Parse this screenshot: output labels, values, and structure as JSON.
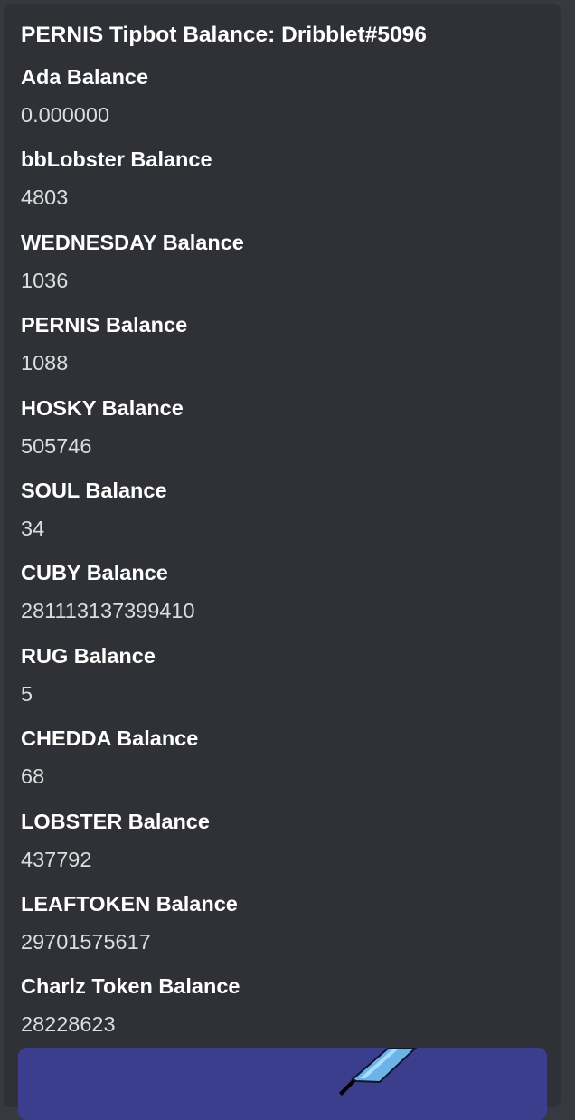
{
  "embed": {
    "title": "PERNIS Tipbot Balance: Dribblet#5096",
    "fields": [
      {
        "name": "Ada Balance",
        "value": "0.000000"
      },
      {
        "name": "bbLobster Balance",
        "value": "4803"
      },
      {
        "name": "WEDNESDAY Balance",
        "value": "1036"
      },
      {
        "name": "PERNIS Balance",
        "value": "1088"
      },
      {
        "name": "HOSKY Balance",
        "value": "505746"
      },
      {
        "name": "SOUL Balance",
        "value": "34"
      },
      {
        "name": "CUBY Balance",
        "value": "28111313739​9410"
      },
      {
        "name": "RUG Balance",
        "value": "5"
      },
      {
        "name": "CHEDDA Balance",
        "value": "68"
      },
      {
        "name": "LOBSTER Balance",
        "value": "437792"
      },
      {
        "name": "LEAFTOKEN Balance",
        "value": "29701575617"
      },
      {
        "name": "Charlz Token Balance",
        "value": "28228623"
      }
    ]
  },
  "colors": {
    "background": "#36393f",
    "embed_background": "#2f3136",
    "title_text": "#ffffff",
    "value_text": "#dcddde",
    "image_background": "#3b3e8c"
  }
}
